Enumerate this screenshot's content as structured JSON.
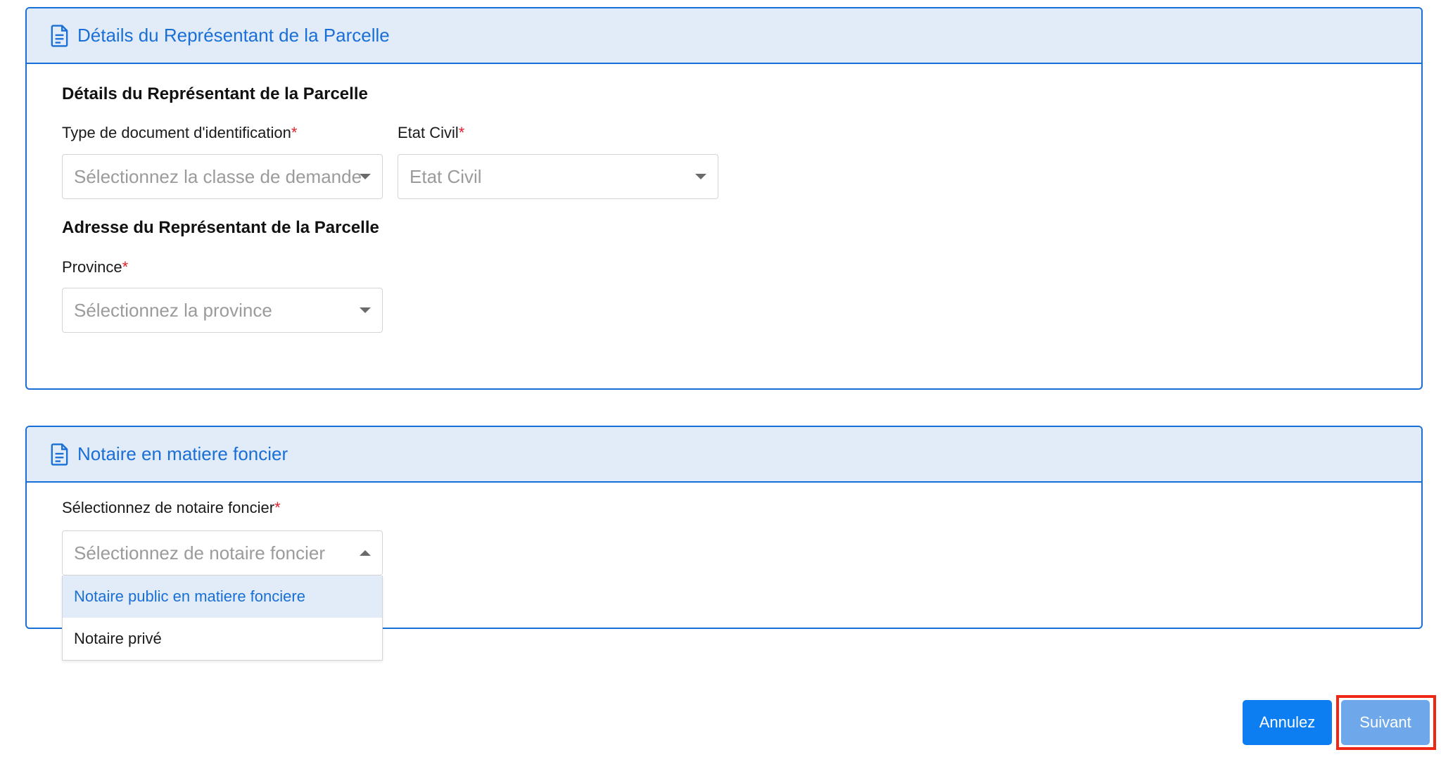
{
  "representative_card": {
    "header_title": "Détails du Représentant de la Parcelle",
    "section_title": "Détails du Représentant de la Parcelle",
    "id_doc_type": {
      "label": "Type de document d'identification",
      "required_mark": "*",
      "placeholder": "Sélectionnez la classe de demande"
    },
    "civil_status": {
      "label": "Etat Civil",
      "required_mark": "*",
      "placeholder": "Etat Civil"
    },
    "address_title": "Adresse du Représentant de la Parcelle",
    "province": {
      "label": "Province",
      "required_mark": "*",
      "placeholder": "Sélectionnez la province"
    }
  },
  "notary_card": {
    "header_title": "Notaire en matiere foncier",
    "notary_select": {
      "label": "Sélectionnez de notaire foncier",
      "required_mark": "*",
      "placeholder": "Sélectionnez de notaire foncier",
      "options": [
        "Notaire public en matiere fonciere",
        "Notaire privé"
      ]
    }
  },
  "actions": {
    "cancel_label": "Annulez",
    "next_label": "Suivant"
  },
  "colors": {
    "accent": "#1a6fd6",
    "header_bg": "#e2ecf8",
    "required": "#e0202a",
    "cancel_button": "#0d7df2",
    "next_button": "#6fa8ea",
    "highlight_box": "#ee2716"
  },
  "icons": {
    "card_header": "document-icon",
    "select_closed": "caret-down-icon",
    "select_open": "caret-up-icon"
  }
}
